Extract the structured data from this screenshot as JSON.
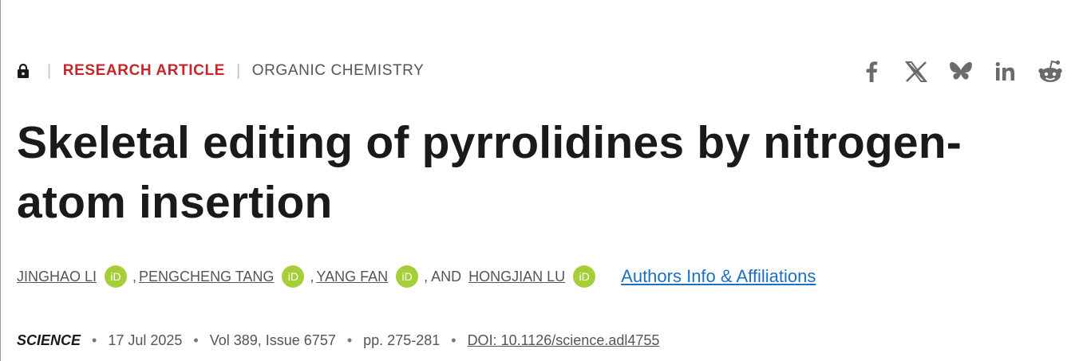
{
  "header": {
    "article_type": "RESEARCH ARTICLE",
    "subject": "ORGANIC CHEMISTRY",
    "separator": "|"
  },
  "share_icons": [
    "facebook-icon",
    "x-icon",
    "bluesky-icon",
    "linkedin-icon",
    "reddit-icon"
  ],
  "title": "Skeletal editing of pyrrolidines by nitrogen-atom insertion",
  "authors": {
    "list": [
      "JINGHAO LI",
      "PENGCHENG TANG",
      "YANG FAN",
      "HONGJIAN LU"
    ],
    "comma": ",",
    "and_text": ", AND",
    "orcid_label": "iD",
    "affiliations_link": "Authors Info & Affiliations"
  },
  "meta": {
    "journal": "SCIENCE",
    "date": "17 Jul 2025",
    "volume": "Vol 389, Issue 6757",
    "pages": "pp. 275-281",
    "doi": "DOI: 10.1126/science.adl4755",
    "bullet": "•"
  },
  "colors": {
    "accent_red": "#c1272d",
    "link_blue": "#1c6fc1",
    "orcid_green": "#a6ce39",
    "text_dark": "#1a1a1a",
    "text_gray": "#555555"
  }
}
